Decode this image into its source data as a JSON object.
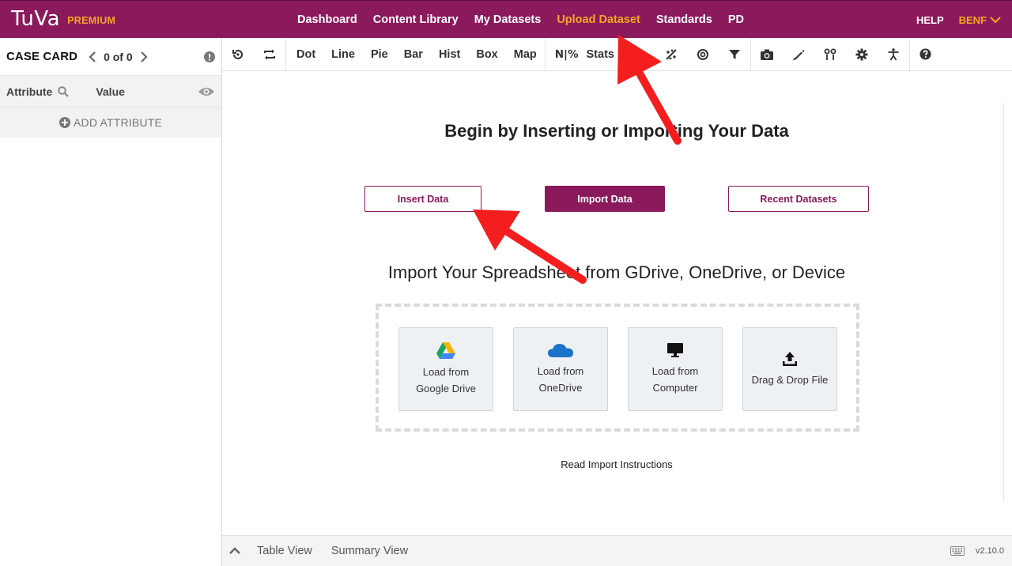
{
  "brand": {
    "logo_text": "TuVa",
    "tier": "PREMIUM"
  },
  "nav": {
    "links": [
      "Dashboard",
      "Content Library",
      "My Datasets",
      "Upload Dataset",
      "Standards",
      "PD"
    ],
    "active": "Upload Dataset",
    "help": "HELP",
    "user": "BENF"
  },
  "case_card": {
    "title": "CASE CARD",
    "count": "0 of 0",
    "col_attribute": "Attribute",
    "col_value": "Value",
    "add_attribute": "ADD ATTRIBUTE"
  },
  "toolbar": {
    "chart_types": [
      "Dot",
      "Line",
      "Pie",
      "Bar",
      "Hist",
      "Box",
      "Map"
    ],
    "number_percent": "N|%",
    "stats": "Stats",
    "icons": [
      "reset-icon",
      "swap-icon",
      "number-percent-icon",
      "stats-icon",
      "axis-icon",
      "trend-icon",
      "target-icon",
      "filter-icon",
      "camera-icon",
      "pencil-icon",
      "people-icon",
      "gear-icon",
      "accessibility-icon",
      "help-icon"
    ]
  },
  "main": {
    "begin_title": "Begin by Inserting or Importing Your Data",
    "buttons": {
      "insert": "Insert Data",
      "import": "Import Data",
      "recent": "Recent Datasets"
    },
    "import_title": "Import Your Spreadsheet from GDrive, OneDrive, or Device",
    "tiles": [
      {
        "line1": "Load from",
        "line2": "Google Drive",
        "icon": "google-drive-icon"
      },
      {
        "line1": "Load from",
        "line2": "OneDrive",
        "icon": "onedrive-icon"
      },
      {
        "line1": "Load from",
        "line2": "Computer",
        "icon": "monitor-icon"
      },
      {
        "line1": "Drag & Drop File",
        "line2": "",
        "icon": "upload-icon"
      }
    ],
    "read_instructions": "Read Import Instructions"
  },
  "bottom": {
    "tabs": [
      "Table View",
      "Summary View"
    ],
    "version": "v2.10.0"
  },
  "colors": {
    "brand": "#8b1a5c",
    "accent": "#f5a623",
    "annotation": "#f51e1e"
  }
}
